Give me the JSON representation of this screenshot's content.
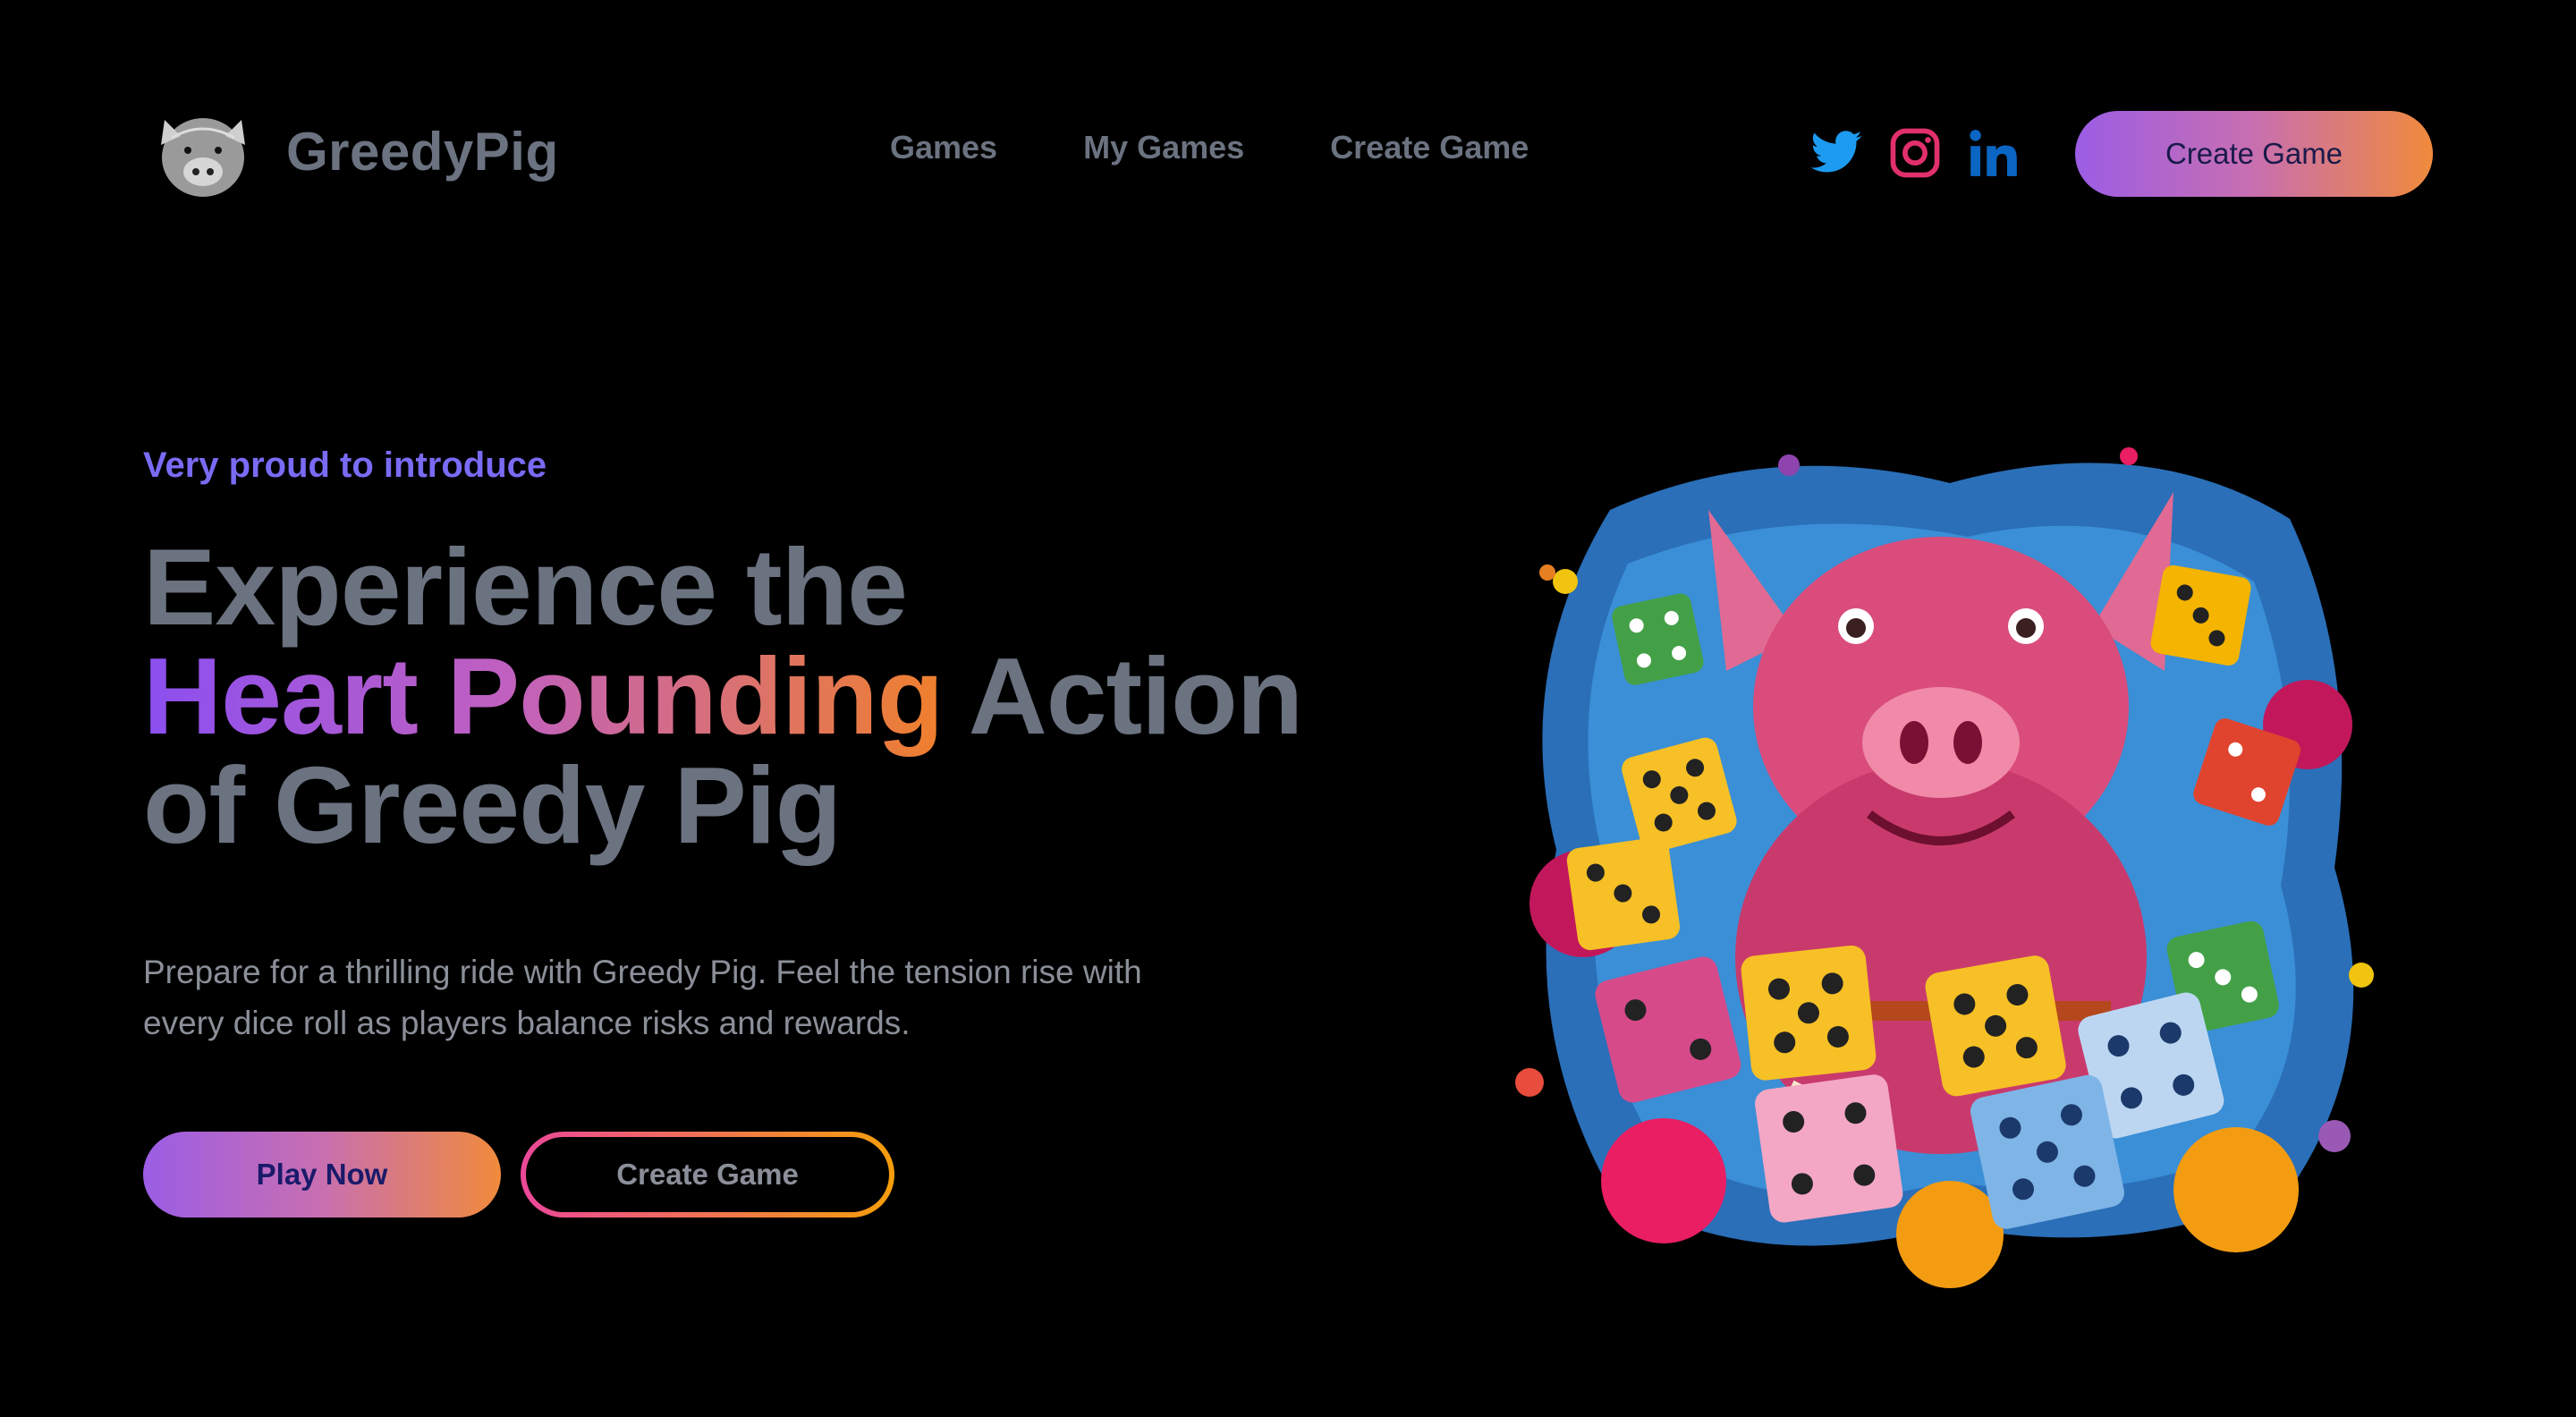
{
  "header": {
    "logo": {
      "icon": "pig-head-icon"
    },
    "brand": "GreedyPig",
    "nav": [
      {
        "label": "Games"
      },
      {
        "label": "My Games"
      },
      {
        "label": "Create Game"
      }
    ],
    "social": [
      {
        "icon": "twitter-icon",
        "color": "#1d9bf0"
      },
      {
        "icon": "instagram-icon",
        "color": "#e1306c"
      },
      {
        "icon": "linkedin-icon",
        "color": "#0a66c2"
      }
    ],
    "cta_label": "Create Game"
  },
  "hero": {
    "eyebrow": "Very proud to introduce",
    "headline": {
      "line1": "Experience the",
      "highlight": "Heart Pounding",
      "after_highlight": " Action",
      "line3": "of Greedy Pig"
    },
    "description": "Prepare for a thrilling ride with Greedy Pig. Feel the tension rise with every dice roll as players balance risks and rewards.",
    "primary_button": "Play Now",
    "secondary_button": "Create Game",
    "illustration": "pig-with-dice-illustration"
  },
  "colors": {
    "background": "#000000",
    "text_gray": "#6b7280",
    "eyebrow_purple": "#7a6bf5",
    "gradient_start": "#9b5de5",
    "gradient_end": "#f08a3c"
  }
}
